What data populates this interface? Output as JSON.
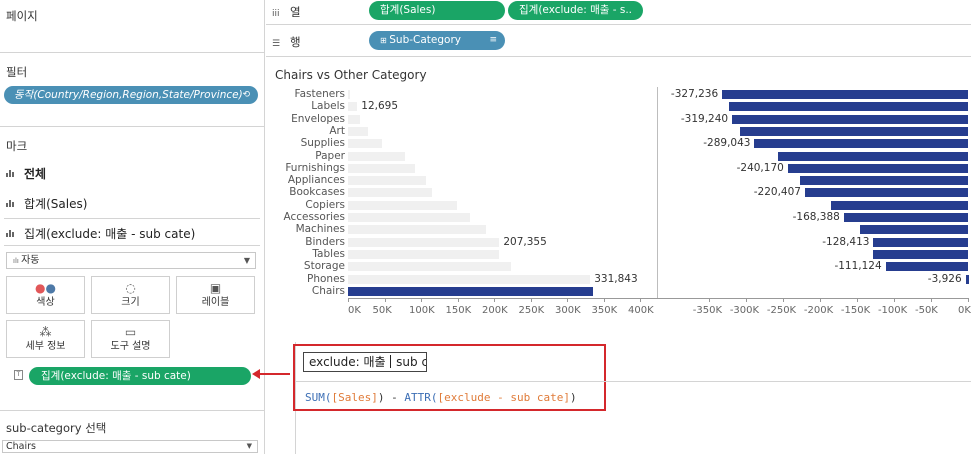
{
  "left_panel": {
    "pages_title": "페이지",
    "filters_title": "필터",
    "filter_pill": "동작(Country/Region,Region,State/Province)",
    "marks_title": "마크",
    "marks_rows": [
      "전체",
      "합계(Sales)",
      "집계(exclude: 매출 - sub cate)"
    ],
    "mark_type": "자동",
    "mark_buttons": [
      {
        "label": "색상",
        "icon": "color-dots-icon"
      },
      {
        "label": "크기",
        "icon": "size-icon"
      },
      {
        "label": "레이블",
        "icon": "label-icon"
      },
      {
        "label": "세부 정보",
        "icon": "detail-icon"
      },
      {
        "label": "도구 설명",
        "icon": "tooltip-icon"
      }
    ],
    "label_pill": "집계(exclude: 매출 - sub cate)",
    "parameter_title": "sub-category 선택",
    "parameter_value": "Chairs"
  },
  "shelves": {
    "columns_label": "열",
    "rows_label": "행",
    "column_pills": [
      "합계(Sales)",
      "집계(exclude: 매출 - s.."
    ],
    "row_pill": "Sub-Category"
  },
  "chart_data": [
    {
      "type": "bar",
      "title": "Chairs vs Other Category",
      "orientation": "horizontal",
      "categories": [
        "Fasteners",
        "Labels",
        "Envelopes",
        "Art",
        "Supplies",
        "Paper",
        "Furnishings",
        "Appliances",
        "Bookcases",
        "Copiers",
        "Accessories",
        "Machines",
        "Binders",
        "Tables",
        "Storage",
        "Phones",
        "Chairs"
      ],
      "series": [
        {
          "values": [
            3024,
            12695,
            16476,
            27119,
            46674,
            78479,
            91705,
            107532,
            114880,
            149528,
            167380,
            189239,
            207355,
            206966,
            223844,
            331843,
            335043
          ]
        }
      ],
      "data_labels": {
        "Labels": "12,695",
        "Binders": "207,355",
        "Phones": "331,843"
      },
      "highlight_category": "Chairs",
      "xlim": [
        0,
        400000
      ],
      "x_ticks": [
        "0K",
        "50K",
        "100K",
        "150K",
        "200K",
        "250K",
        "300K",
        "350K",
        "400K"
      ],
      "colors": {
        "default": "#f0f0f0",
        "highlight": "#263d8f"
      }
    },
    {
      "type": "bar",
      "orientation": "horizontal",
      "categories": [
        "Fasteners",
        "Labels",
        "Envelopes",
        "Art",
        "Supplies",
        "Paper",
        "Furnishings",
        "Appliances",
        "Bookcases",
        "Copiers",
        "Accessories",
        "Machines",
        "Binders",
        "Tables",
        "Storage",
        "Phones",
        "Chairs"
      ],
      "series": [
        {
          "values": [
            -332019,
            -322348,
            -318567,
            -307924,
            -288369,
            -256564,
            -243338,
            -227511,
            -220163,
            -185515,
            -167663,
            -145804,
            -127688,
            -128077,
            -111199,
            -3200,
            0
          ]
        }
      ],
      "data_labels": {
        "Fasteners": "-327,236",
        "Envelopes": "-319,240",
        "Supplies": "-289,043",
        "Furnishings": "-240,170",
        "Bookcases": "-220,407",
        "Accessories": "-168,388",
        "Binders": "-128,413",
        "Storage": "-111,124",
        "Phones": "-3,926"
      },
      "xlim": [
        -370000,
        0
      ],
      "x_ticks": [
        "-350K",
        "-300K",
        "-250K",
        "-200K",
        "-150K",
        "-100K",
        "-50K",
        "0K"
      ],
      "colors": {
        "bar": "#263d8f"
      }
    }
  ],
  "calc_editor": {
    "name_value_before_cursor": "exclude: 매출 ",
    "name_value_after_cursor": " sub c",
    "formula": {
      "fn1": "SUM(",
      "field1": "[Sales]",
      "mid": ") - ",
      "fn2": "ATTR(",
      "field2": "[exclude - sub cate]",
      "end": ")"
    }
  }
}
